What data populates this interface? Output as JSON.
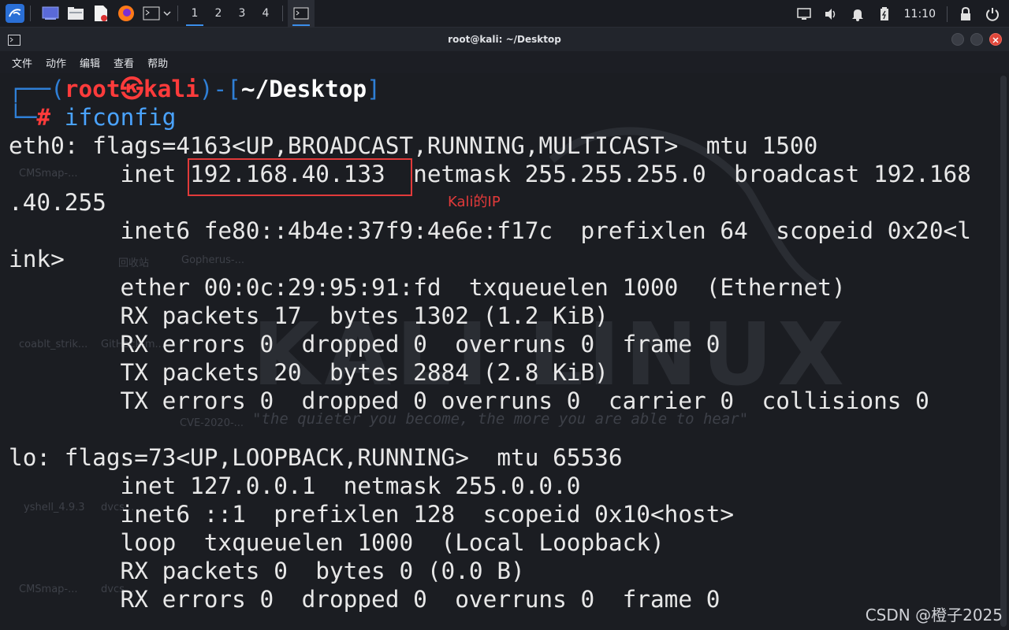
{
  "taskbar": {
    "workspaces": [
      "1",
      "2",
      "3",
      "4"
    ],
    "active_workspace": "1",
    "clock": "11:10",
    "icons": [
      "kali-menu-icon",
      "desktop-icon",
      "file-manager-icon",
      "text-editor-icon",
      "firefox-icon",
      "terminal-icon"
    ]
  },
  "window": {
    "title": "root@kali: ~/Desktop"
  },
  "menubar": {
    "items": [
      "文件",
      "动作",
      "编辑",
      "查看",
      "帮助"
    ]
  },
  "prompt": {
    "user": "root",
    "host": "kali",
    "path": "~/Desktop",
    "command": "ifconfig"
  },
  "output": {
    "lines": [
      "eth0: flags=4163<UP,BROADCAST,RUNNING,MULTICAST>  mtu 1500",
      "        inet 192.168.40.133  netmask 255.255.255.0  broadcast 192.168",
      ".40.255",
      "        inet6 fe80::4b4e:37f9:4e6e:f17c  prefixlen 64  scopeid 0x20<l",
      "ink>",
      "        ether 00:0c:29:95:91:fd  txqueuelen 1000  (Ethernet)",
      "        RX packets 17  bytes 1302 (1.2 KiB)",
      "        RX errors 0  dropped 0  overruns 0  frame 0",
      "        TX packets 20  bytes 2884 (2.8 KiB)",
      "        TX errors 0  dropped 0 overruns 0  carrier 0  collisions 0",
      "",
      "lo: flags=73<UP,LOOPBACK,RUNNING>  mtu 65536",
      "        inet 127.0.0.1  netmask 255.0.0.0",
      "        inet6 ::1  prefixlen 128  scopeid 0x10<host>",
      "        loop  txqueuelen 1000  (Local Loopback)",
      "        RX packets 0  bytes 0 (0.0 B)",
      "        RX errors 0  dropped 0  overruns 0  frame 0"
    ]
  },
  "annotation": {
    "label": "Kali的IP",
    "color": "#e23a3a"
  },
  "wallpaper": {
    "slogan": "\"the quieter you become, the more you are able to hear\"",
    "desktop_icons": [
      "CMSmap-...",
      "回收站",
      "Gopherus-...",
      "coablt_strik...",
      "GitHack-m...",
      "CVE-2020-...",
      "yshell_4.9.3",
      "dvcs...",
      "CMSmap-...",
      "dvcs..."
    ]
  },
  "watermark": "CSDN @橙子2025"
}
